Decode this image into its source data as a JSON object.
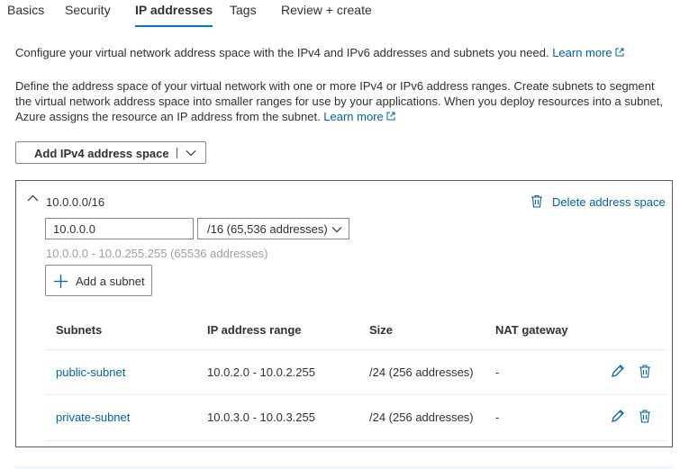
{
  "tabs": [
    {
      "label": "Basics"
    },
    {
      "label": "Security"
    },
    {
      "label": "IP addresses"
    },
    {
      "label": "Tags"
    },
    {
      "label": "Review + create"
    }
  ],
  "intro": {
    "text": "Configure your virtual network address space with the IPv4 and IPv6 addresses and subnets you need. ",
    "link": "Learn more"
  },
  "description": {
    "text": "Define the address space of your virtual network with one or more IPv4 or IPv6 address ranges. Create subnets to segment the virtual network address space into smaller ranges for use by your applications. When you deploy resources into a subnet, Azure assigns the resource an IP address from the subnet. ",
    "link": "Learn more"
  },
  "add_space_button": {
    "label": "Add IPv4 address space"
  },
  "address_space": {
    "title": "10.0.0.0/16",
    "delete_label": "Delete address space",
    "ip_value": "10.0.0.0",
    "prefix_value": "/16 (65,536 addresses)",
    "range_hint": "10.0.0.0 - 10.0.255.255 (65536 addresses)",
    "add_subnet_label": "Add a subnet"
  },
  "subnet_table": {
    "columns": [
      "Subnets",
      "IP address range",
      "Size",
      "NAT gateway"
    ],
    "rows": [
      {
        "name": "public-subnet",
        "range": "10.0.2.0 - 10.0.2.255",
        "size": "/24 (256 addresses)",
        "nat": "-"
      },
      {
        "name": "private-subnet",
        "range": "10.0.3.0 - 10.0.3.255",
        "size": "/24 (256 addresses)",
        "nat": "-"
      }
    ]
  },
  "icons": {
    "external_link": "external-link-icon",
    "chevron": "chevron-down-icon",
    "collapse": "chevron-up-icon",
    "delete": "trash-icon",
    "edit": "pencil-icon",
    "add": "plus-icon"
  },
  "colors": {
    "accent": "#0078d4",
    "link": "#0062ad",
    "border": "#8a8886",
    "muted_text": "#a19f9d"
  }
}
